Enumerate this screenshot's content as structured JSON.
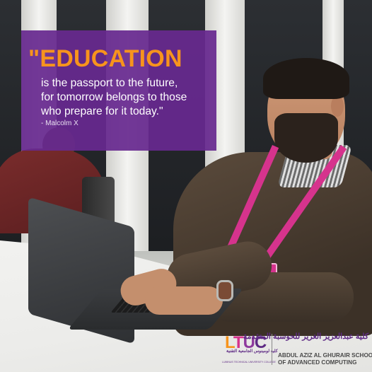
{
  "quote": {
    "headline": "\"EDUCATION",
    "lines": [
      "is the passport to the future,",
      "for tomorrow belongs to those",
      "who prepare for it today.\""
    ],
    "author": "- Malcolm X"
  },
  "logo": {
    "l": "L",
    "t": "T",
    "u": "U",
    "c": "C",
    "arabic_short": "كلية لومينوس الجامعية التقنية",
    "english_small": "LUMINUS TECHNICAL UNIVERSITY COLLEGE",
    "arabic_school": "كلية عبدالعزيز الغرير للحوسبة المتقدمة",
    "school_line1": "ABDUL AZIZ AL GHURAIR SCHOOL",
    "school_line2": "OF ADVANCED COMPUTING"
  },
  "colors": {
    "quote_box": "#67298f",
    "headline": "#f7941d",
    "lanyard": "#d6338d"
  }
}
